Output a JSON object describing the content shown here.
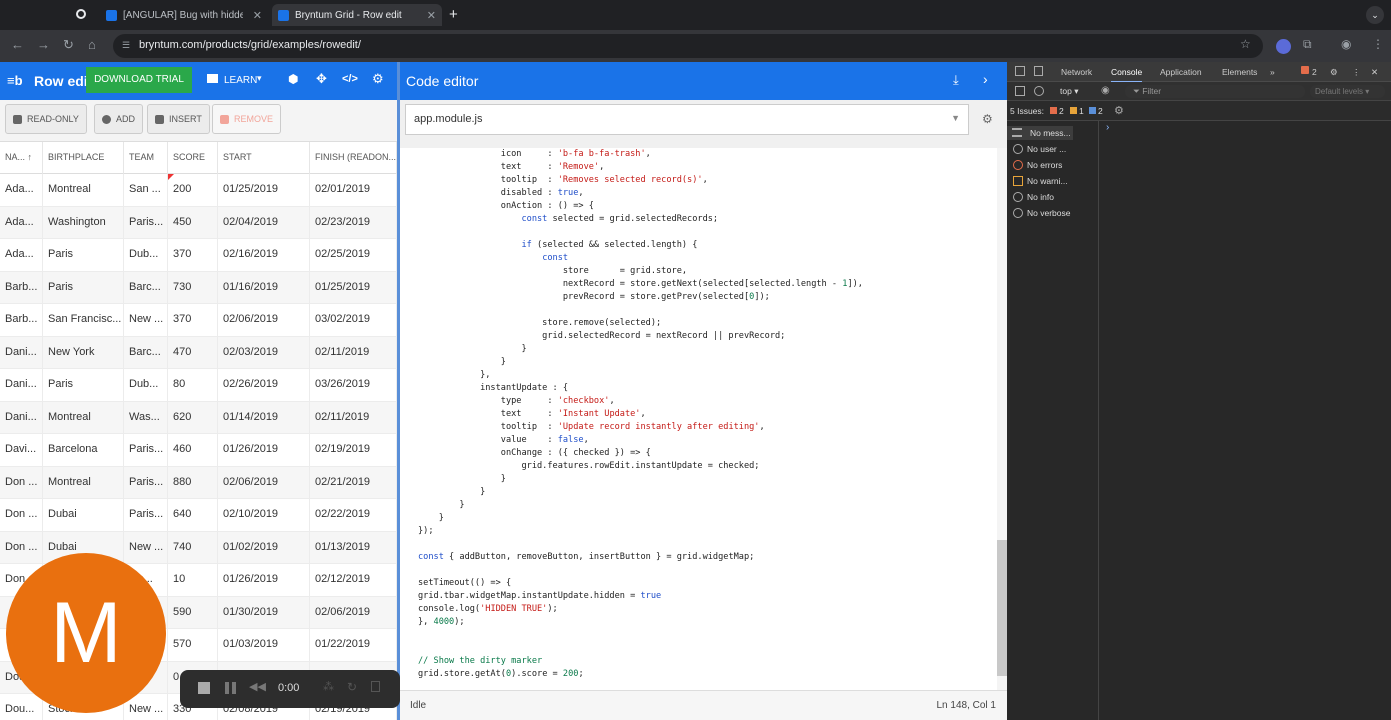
{
  "browser": {
    "tabs": [
      {
        "title": "[ANGULAR] Bug with hidden"
      },
      {
        "title": "Bryntum Grid - Row edit"
      }
    ],
    "url": "bryntum.com/products/grid/examples/rowedit/"
  },
  "app": {
    "title": "Row edi",
    "download_label": "DOWNLOAD TRIAL",
    "learn_label": "LEARN",
    "toolbar": {
      "readonly": "READ-ONLY",
      "add": "ADD",
      "insert": "INSERT",
      "remove": "REMOVE"
    },
    "columns": [
      "NA...",
      "BIRTHPLACE",
      "TEAM",
      "SCORE",
      "START",
      "FINISH (READON..."
    ],
    "rows": [
      [
        "Ada...",
        "Montreal",
        "San ...",
        "200",
        "01/25/2019",
        "02/01/2019"
      ],
      [
        "Ada...",
        "Washington",
        "Paris...",
        "450",
        "02/04/2019",
        "02/23/2019"
      ],
      [
        "Ada...",
        "Paris",
        "Dub...",
        "370",
        "02/16/2019",
        "02/25/2019"
      ],
      [
        "Barb...",
        "Paris",
        "Barc...",
        "730",
        "01/16/2019",
        "01/25/2019"
      ],
      [
        "Barb...",
        "San Francisc...",
        "New ...",
        "370",
        "02/06/2019",
        "03/02/2019"
      ],
      [
        "Dani...",
        "New York",
        "Barc...",
        "470",
        "02/03/2019",
        "02/11/2019"
      ],
      [
        "Dani...",
        "Paris",
        "Dub...",
        "80",
        "02/26/2019",
        "03/26/2019"
      ],
      [
        "Dani...",
        "Montreal",
        "Was...",
        "620",
        "01/14/2019",
        "02/11/2019"
      ],
      [
        "Davi...",
        "Barcelona",
        "Paris...",
        "460",
        "01/26/2019",
        "02/19/2019"
      ],
      [
        "Don ...",
        "Montreal",
        "Paris...",
        "880",
        "02/06/2019",
        "02/21/2019"
      ],
      [
        "Don ...",
        "Dubai",
        "Paris...",
        "640",
        "02/10/2019",
        "02/22/2019"
      ],
      [
        "Don ...",
        "Dubai",
        "New ...",
        "740",
        "01/02/2019",
        "01/13/2019"
      ],
      [
        "Don...",
        "",
        "...c...",
        "10",
        "01/26/2019",
        "02/12/2019"
      ],
      [
        "",
        "",
        "",
        "590",
        "01/30/2019",
        "02/06/2019"
      ],
      [
        "",
        "",
        "",
        "570",
        "01/03/2019",
        "01/22/2019"
      ],
      [
        "Dou...",
        "",
        "",
        "0",
        "",
        "..."
      ],
      [
        "Dou...",
        "Stockholm",
        "New ...",
        "330",
        "02/08/2019",
        "02/19/2019"
      ]
    ]
  },
  "editor": {
    "title": "Code editor",
    "file": "app.module.js",
    "status": "Idle",
    "position": "Ln 148, Col 1",
    "lines": [
      "                icon     : 'b-fa b-fa-trash',",
      "                text     : 'Remove',",
      "                tooltip  : 'Removes selected record(s)',",
      "                disabled : true,",
      "                onAction : () => {",
      "                    const selected = grid.selectedRecords;",
      "",
      "                    if (selected && selected.length) {",
      "                        const",
      "                            store      = grid.store,",
      "                            nextRecord = store.getNext(selected[selected.length - 1]),",
      "                            prevRecord = store.getPrev(selected[0]);",
      "",
      "                        store.remove(selected);",
      "                        grid.selectedRecord = nextRecord || prevRecord;",
      "                    }",
      "                }",
      "            },",
      "            instantUpdate : {",
      "                type     : 'checkbox',",
      "                text     : 'Instant Update',",
      "                tooltip  : 'Update record instantly after editing',",
      "                value    : false,",
      "                onChange : ({ checked }) => {",
      "                    grid.features.rowEdit.instantUpdate = checked;",
      "                }",
      "            }",
      "        }",
      "    }",
      "});",
      "",
      "const { addButton, removeButton, insertButton } = grid.widgetMap;",
      "",
      "setTimeout(() => {",
      "grid.tbar.widgetMap.instantUpdate.hidden = true",
      "console.log('HIDDEN TRUE');",
      "}, 4000);",
      "",
      "",
      "// Show the dirty marker",
      "grid.store.getAt(0).score = 200;"
    ]
  },
  "devtools": {
    "tabs": [
      "Network",
      "Console",
      "Application",
      "Elements"
    ],
    "context": "top",
    "filter_placeholder": "Filter",
    "levels": "Default levels",
    "issues_label": "5 Issues:",
    "issue_counts": [
      "2",
      "1",
      "2"
    ],
    "badge": "2",
    "sidebar": [
      "No mess...",
      "No user ...",
      "No errors",
      "No warni...",
      "No info",
      "No verbose"
    ]
  },
  "avatar": {
    "letter": "M",
    "color": "#e9700f"
  },
  "recorder": {
    "time": "0:00"
  }
}
